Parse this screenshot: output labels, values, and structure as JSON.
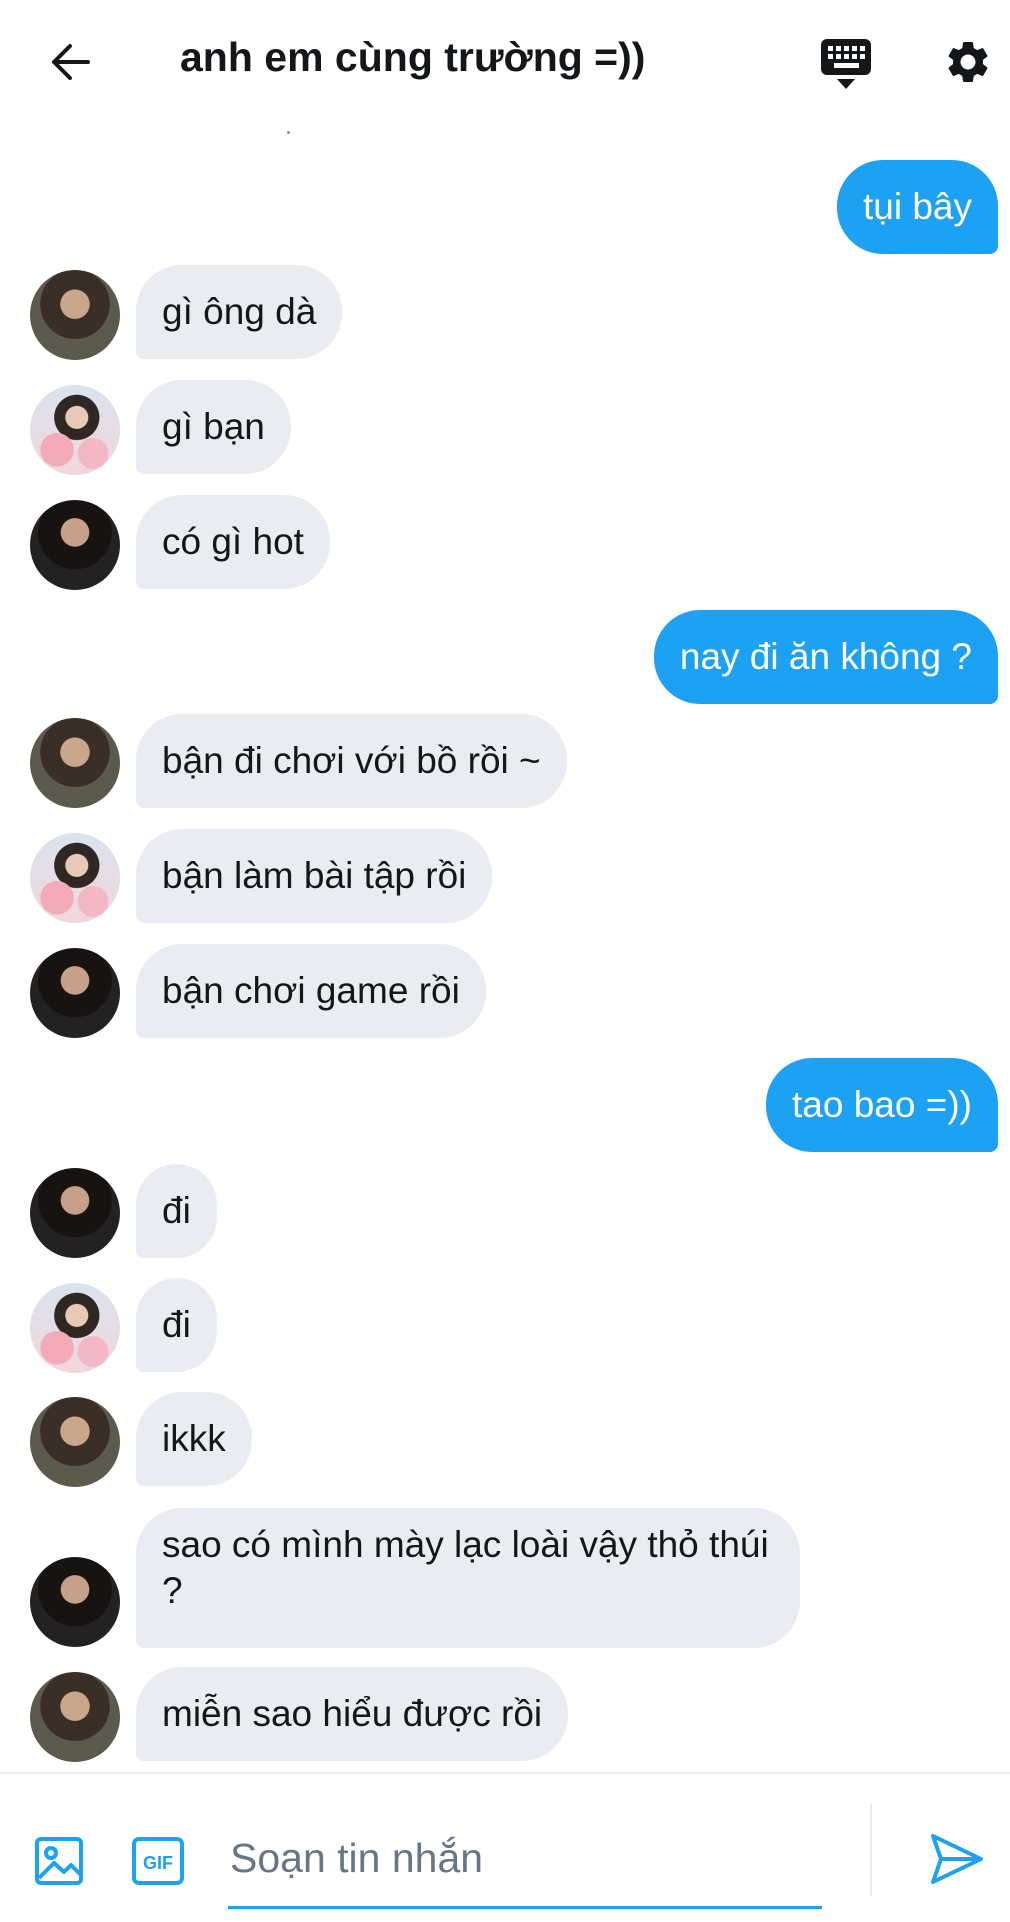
{
  "header": {
    "title": "anh em cùng trường =))",
    "back_icon": "arrow-left-icon",
    "keyboard_icon": "keyboard-icon",
    "settings_icon": "gear-icon"
  },
  "messages": [
    {
      "direction": "outgoing",
      "text": "tụi bây"
    },
    {
      "direction": "incoming",
      "avatar": "avatar-1",
      "text": "gì ông dà"
    },
    {
      "direction": "incoming",
      "avatar": "avatar-2",
      "text": "gì bạn"
    },
    {
      "direction": "incoming",
      "avatar": "avatar-3",
      "text": "có gì hot"
    },
    {
      "direction": "outgoing",
      "text": "nay đi ăn không ?"
    },
    {
      "direction": "incoming",
      "avatar": "avatar-1",
      "text": "bận đi chơi với bồ rồi ~"
    },
    {
      "direction": "incoming",
      "avatar": "avatar-2",
      "text": "bận làm bài tập rồi"
    },
    {
      "direction": "incoming",
      "avatar": "avatar-3",
      "text": "bận chơi game rồi"
    },
    {
      "direction": "outgoing",
      "text": "tao bao =))"
    },
    {
      "direction": "incoming",
      "avatar": "avatar-3",
      "text": "đi"
    },
    {
      "direction": "incoming",
      "avatar": "avatar-2",
      "text": "đi"
    },
    {
      "direction": "incoming",
      "avatar": "avatar-1",
      "text": "ikkk"
    },
    {
      "direction": "incoming",
      "avatar": "avatar-3",
      "text": "sao có mình mày lạc loài vậy thỏ thúi ?"
    },
    {
      "direction": "incoming",
      "avatar": "avatar-1",
      "text": "miễn sao hiểu được rồi"
    }
  ],
  "composer": {
    "placeholder": "Soạn tin nhắn",
    "value": "",
    "gif_label": "GIF",
    "image_icon": "image-icon",
    "send_icon": "send-icon"
  },
  "colors": {
    "accent": "#1da1f2",
    "incoming_bubble": "#e9ecf0",
    "text": "#14171a",
    "muted": "#657786"
  }
}
